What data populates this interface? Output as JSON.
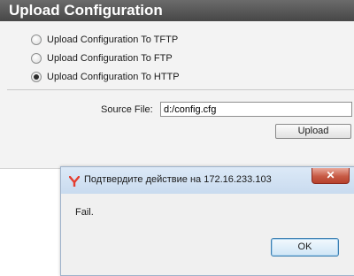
{
  "panel": {
    "title": "Upload Configuration",
    "options": [
      {
        "label": "Upload Configuration To TFTP",
        "selected": false
      },
      {
        "label": "Upload Configuration To FTP",
        "selected": false
      },
      {
        "label": "Upload Configuration To HTTP",
        "selected": true
      }
    ],
    "source_file_label": "Source File:",
    "source_file_value": "d:/config.cfg",
    "upload_button_label": "Upload"
  },
  "dialog": {
    "title": "Подтвердите действие на 172.16.233.103",
    "message": "Fail.",
    "ok_label": "OK",
    "close_icon": "close-icon",
    "browser_icon": "yandex-browser-icon"
  },
  "colors": {
    "header_bg": "#555555",
    "panel_bg": "#f3f3f3",
    "dialog_titlebar": "#d4e3f4",
    "close_button": "#c75a45",
    "browser_icon": "#e53d2f"
  }
}
